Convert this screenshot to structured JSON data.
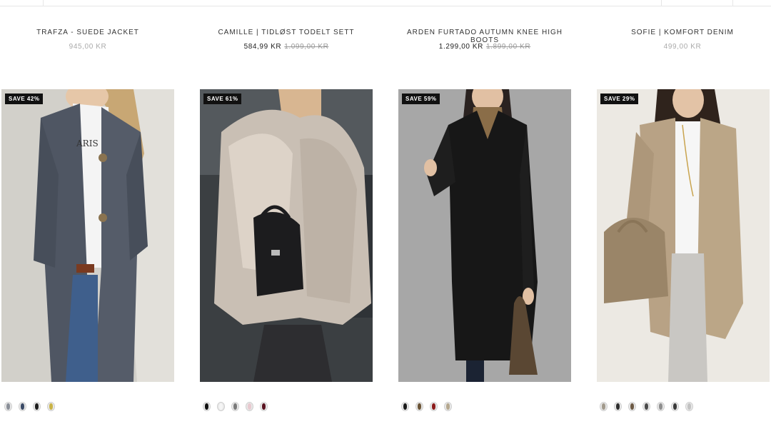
{
  "products": [
    {
      "title": "TRAFZA - SUEDE JACKET",
      "price": "945,00 KR",
      "old_price": "",
      "badge": "SAVE 42%",
      "swatches": [
        "#8a8f98",
        "#3b4a66",
        "#1d1d1d",
        "#c9b347"
      ]
    },
    {
      "title": "CAMILLE | TIDLØST TODELT SETT",
      "price": "584,99 KR",
      "old_price": "1.099,00 KR",
      "badge": "SAVE 61%",
      "swatches": [
        "#111111",
        "#f5f5f5",
        "#7a7a7a",
        "#e8c9cf",
        "#5a1320"
      ]
    },
    {
      "title": "ARDEN FURTADO AUTUMN KNEE HIGH BOOTS",
      "price": "1.299,00 KR",
      "old_price": "1.899,00 KR",
      "badge": "SAVE 59%",
      "swatches": [
        "#1a1a1a",
        "#6b5436",
        "#8c1b1b",
        "#b5a88f"
      ]
    },
    {
      "title": "SOFIE | KOMFORT DENIM",
      "price": "499,00 KR",
      "old_price": "",
      "badge": "SAVE 29%",
      "swatches": [
        "#a29a8c",
        "#2e2e2e",
        "#6d5a45",
        "#4a4a4a",
        "#8f8f8f",
        "#3a3a3a",
        "#c2c2c2"
      ]
    }
  ]
}
